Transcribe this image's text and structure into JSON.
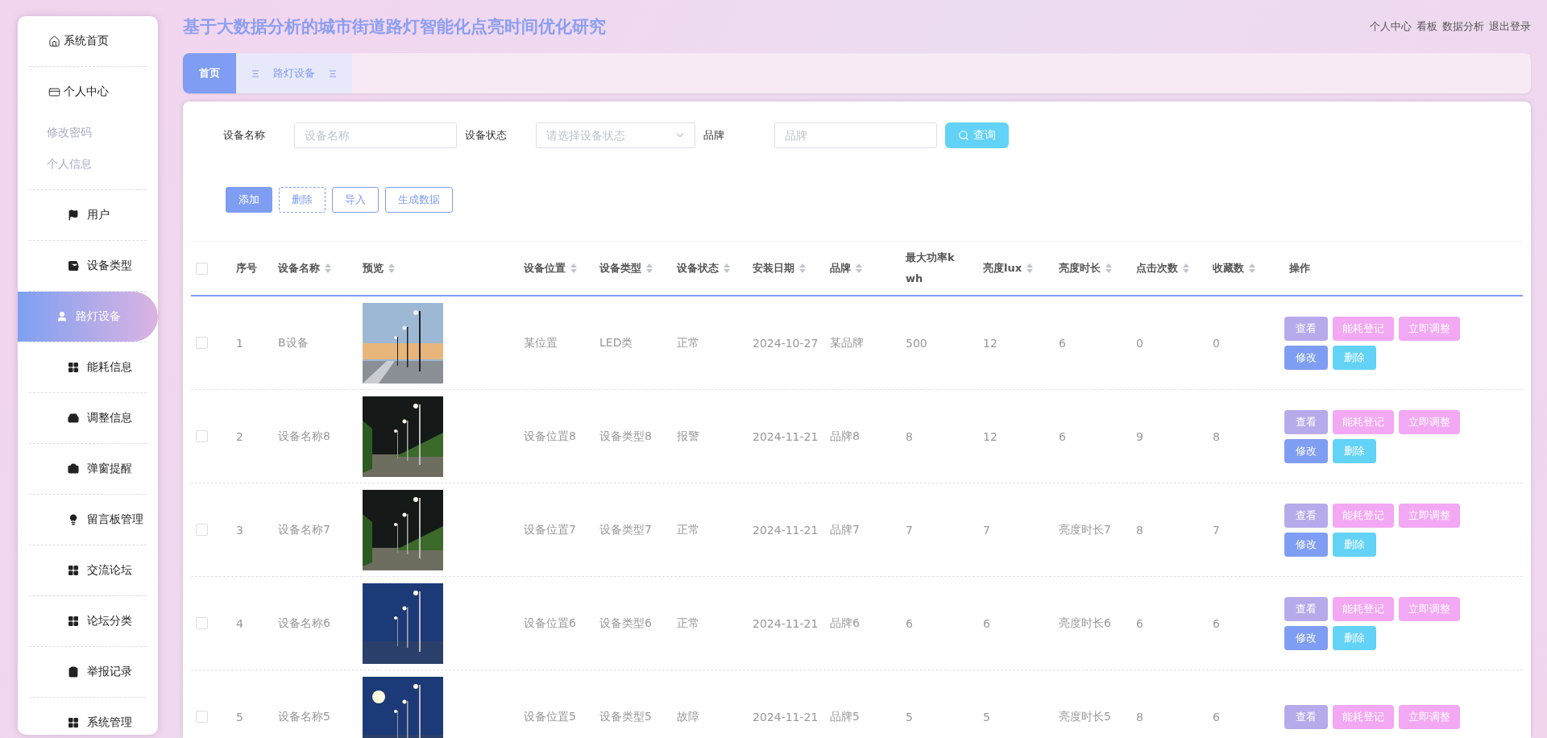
{
  "header": {
    "title": "基于大数据分析的城市街道路灯智能化点亮时间优化研究",
    "links": [
      "个人中心",
      "看板",
      "数据分析",
      "退出登录"
    ]
  },
  "tabs": [
    {
      "label": "首页",
      "selected": true,
      "menu": false
    },
    {
      "label": "路灯设备",
      "selected": false,
      "menu": true
    }
  ],
  "sidebar": {
    "items": [
      {
        "label": "系统首页",
        "selected": false,
        "kind": "top"
      },
      {
        "label": "个人中心",
        "selected": false,
        "kind": "top",
        "children": [
          {
            "label": "修改密码"
          },
          {
            "label": "个人信息"
          }
        ]
      },
      {
        "label": "用户",
        "selected": false,
        "kind": "menu"
      },
      {
        "label": "设备类型",
        "selected": false,
        "kind": "menu"
      },
      {
        "label": "路灯设备",
        "selected": true,
        "kind": "menu"
      },
      {
        "label": "能耗信息",
        "selected": false,
        "kind": "menu"
      },
      {
        "label": "调整信息",
        "selected": false,
        "kind": "menu"
      },
      {
        "label": "弹窗提醒",
        "selected": false,
        "kind": "menu"
      },
      {
        "label": "留言板管理",
        "selected": false,
        "kind": "menu"
      },
      {
        "label": "交流论坛",
        "selected": false,
        "kind": "menu"
      },
      {
        "label": "论坛分类",
        "selected": false,
        "kind": "menu"
      },
      {
        "label": "举报记录",
        "selected": false,
        "kind": "menu"
      },
      {
        "label": "系统管理",
        "selected": false,
        "kind": "menu"
      }
    ]
  },
  "filters": [
    {
      "label": "设备名称",
      "kind": "input",
      "placeholder": "设备名称"
    },
    {
      "label": "设备状态",
      "kind": "select",
      "placeholder": "请选择设备状态"
    },
    {
      "label": "品牌",
      "kind": "input",
      "placeholder": "品牌"
    }
  ],
  "search_button": "查询",
  "toolbar": [
    {
      "label": "添加",
      "kind": "primary"
    },
    {
      "label": "删除",
      "kind": "dashed"
    },
    {
      "label": "导入",
      "kind": "outline"
    },
    {
      "label": "生成数据",
      "kind": "outline"
    }
  ],
  "table": {
    "select_all": {
      "checked": false
    },
    "columns": [
      {
        "label": "序号",
        "sortable": false
      },
      {
        "label": "设备名称",
        "sortable": true
      },
      {
        "label": "预览",
        "sortable": true
      },
      {
        "label": "设备位置",
        "sortable": true
      },
      {
        "label": "设备类型",
        "sortable": true
      },
      {
        "label": "设备状态",
        "sortable": true
      },
      {
        "label": "安装日期",
        "sortable": true
      },
      {
        "label": "品牌",
        "sortable": true
      },
      {
        "label": "最大功率kwh",
        "sortable": false
      },
      {
        "label": "亮度lux",
        "sortable": true
      },
      {
        "label": "亮度时长",
        "sortable": true
      },
      {
        "label": "点击次数",
        "sortable": true
      },
      {
        "label": "收藏数",
        "sortable": true
      },
      {
        "label": "操作",
        "sortable": false
      }
    ],
    "rows": [
      {
        "checked": false,
        "cells": [
          "1",
          "B设备",
          {
            "kind": "picture"
          },
          "某位置",
          "LED类",
          "正常",
          "2024-10-27",
          "某品牌",
          "500",
          "12",
          "6",
          "0",
          "0"
        ],
        "actions": [
          {
            "label": "查看",
            "kind": "view"
          },
          {
            "label": "能耗登记",
            "kind": "energy"
          },
          {
            "label": "立即调整",
            "kind": "adjust"
          },
          {
            "label": "修改",
            "kind": "edit"
          },
          {
            "label": "删除",
            "kind": "delete"
          }
        ]
      },
      {
        "checked": false,
        "cells": [
          "2",
          "设备名称8",
          {
            "kind": "picture"
          },
          "设备位置8",
          "设备类型8",
          "报警",
          "2024-11-21",
          "品牌8",
          "8",
          "12",
          "6",
          "9",
          "8"
        ],
        "actions": [
          {
            "label": "查看",
            "kind": "view"
          },
          {
            "label": "能耗登记",
            "kind": "energy"
          },
          {
            "label": "立即调整",
            "kind": "adjust"
          },
          {
            "label": "修改",
            "kind": "edit"
          },
          {
            "label": "删除",
            "kind": "delete"
          }
        ]
      },
      {
        "checked": false,
        "cells": [
          "3",
          "设备名称7",
          {
            "kind": "picture"
          },
          "设备位置7",
          "设备类型7",
          "正常",
          "2024-11-21",
          "品牌7",
          "7",
          "7",
          "亮度时长7",
          "8",
          "7"
        ],
        "actions": [
          {
            "label": "查看",
            "kind": "view"
          },
          {
            "label": "能耗登记",
            "kind": "energy"
          },
          {
            "label": "立即调整",
            "kind": "adjust"
          },
          {
            "label": "修改",
            "kind": "edit"
          },
          {
            "label": "删除",
            "kind": "delete"
          }
        ]
      },
      {
        "checked": false,
        "cells": [
          "4",
          "设备名称6",
          {
            "kind": "picture"
          },
          "设备位置6",
          "设备类型6",
          "正常",
          "2024-11-21",
          "品牌6",
          "6",
          "6",
          "亮度时长6",
          "6",
          "6"
        ],
        "actions": [
          {
            "label": "查看",
            "kind": "view"
          },
          {
            "label": "能耗登记",
            "kind": "energy"
          },
          {
            "label": "立即调整",
            "kind": "adjust"
          },
          {
            "label": "修改",
            "kind": "edit"
          },
          {
            "label": "删除",
            "kind": "delete"
          }
        ]
      },
      {
        "checked": false,
        "cells": [
          "5",
          "设备名称5",
          {
            "kind": "picture"
          },
          "设备位置5",
          "设备类型5",
          "故障",
          "2024-11-21",
          "品牌5",
          "5",
          "5",
          "亮度时长5",
          "8",
          "6"
        ],
        "actions": [
          {
            "label": "查看",
            "kind": "view"
          },
          {
            "label": "能耗登记",
            "kind": "energy"
          },
          {
            "label": "立即调整",
            "kind": "adjust"
          }
        ]
      }
    ]
  }
}
